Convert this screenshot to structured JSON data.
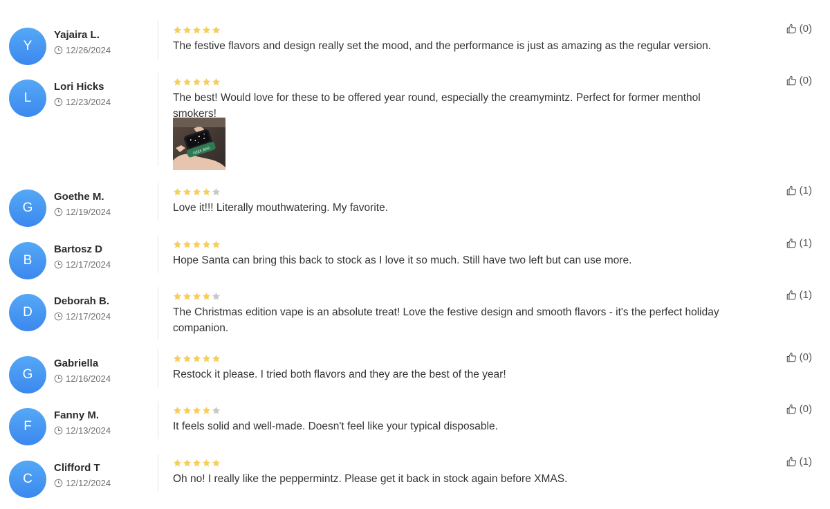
{
  "colors": {
    "avatar": "#4a9bf2",
    "star_filled": "#f5ce5b",
    "star_empty": "#c8c8c8",
    "divider": "#e4e4e4"
  },
  "icons": {
    "date": "clock-icon",
    "helpful": "thumbs-up-icon",
    "rating": "star-icon"
  },
  "reviews": [
    {
      "initial": "Y",
      "author": "Yajaira L.",
      "date": "12/26/2024",
      "rating": 5,
      "text": "The festive flavors and design really set the mood, and the performance is just as amazing as the regular version.",
      "helpful": "(0)"
    },
    {
      "initial": "L",
      "author": "Lori Hicks",
      "date": "12/23/2024",
      "rating": 5,
      "text": "The best! Would love for these to be offered year round, especially the creamymintz. Perfect for former menthol smokers!",
      "helpful": "(0)",
      "photo": {
        "device_label": "GEEK BAR"
      }
    },
    {
      "initial": "G",
      "author": "Goethe M.",
      "date": "12/19/2024",
      "rating": 4,
      "text": "Love it!!! Literally mouthwatering. My favorite.",
      "helpful": "(1)"
    },
    {
      "initial": "B",
      "author": "Bartosz D",
      "date": "12/17/2024",
      "rating": 5,
      "text": "Hope Santa can bring this back to stock as I love it so much. Still have two left but can use more.",
      "helpful": "(1)"
    },
    {
      "initial": "D",
      "author": "Deborah B.",
      "date": "12/17/2024",
      "rating": 4,
      "text": "The Christmas edition vape is an absolute treat! Love the festive design and smooth flavors - it's the perfect holiday companion.",
      "helpful": "(1)"
    },
    {
      "initial": "G",
      "author": "Gabriella",
      "date": "12/16/2024",
      "rating": 5,
      "text": "Restock it please. I tried both flavors and they are the best of the year!",
      "helpful": "(0)"
    },
    {
      "initial": "F",
      "author": "Fanny M.",
      "date": "12/13/2024",
      "rating": 4,
      "text": "It feels solid and well-made. Doesn't feel like your typical disposable.",
      "helpful": "(0)"
    },
    {
      "initial": "C",
      "author": "Clifford T",
      "date": "12/12/2024",
      "rating": 5,
      "text": "Oh no! I really like the peppermintz. Please get it back in stock again before XMAS.",
      "helpful": "(1)"
    }
  ]
}
